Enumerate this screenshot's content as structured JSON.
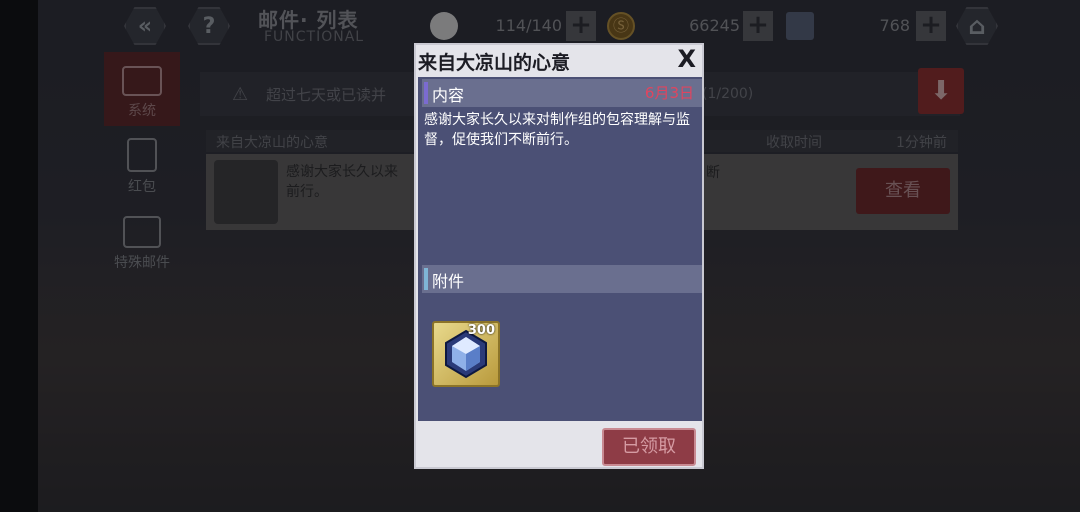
{
  "topbar": {
    "back_icon": "«",
    "help_icon": "?",
    "title": "邮件· 列表",
    "subtitle": "FUNCTIONAL",
    "stamina": "114/140",
    "coins": "66245",
    "gems": "768",
    "plus": "+",
    "home_icon": "⌂",
    "coin_glyph": "Ⓢ"
  },
  "sidebar": {
    "items": [
      {
        "label": "系统"
      },
      {
        "label": "红包"
      },
      {
        "label": "特殊邮件"
      }
    ]
  },
  "main": {
    "notice": "超过七天或已读并",
    "notice_icon": "⚠",
    "count": "(1/200)",
    "download_icon": "⬇",
    "list_header": {
      "title": "来自大凉山的心意",
      "received_label": "收取时间",
      "time": "1分钟前"
    },
    "mail": {
      "preview": "感谢大家长久以来",
      "preview_line2": "前行。",
      "tail": "断",
      "view_button": "查看"
    }
  },
  "modal": {
    "title": "来自大凉山的心意",
    "close": "X",
    "content_label": "内容",
    "date": "6月3日",
    "content": "感谢大家长久以来对制作组的包容理解与监督，促使我们不断前行。",
    "attachment_label": "附件",
    "attachment": {
      "icon": "gem-icon",
      "count": "300"
    },
    "claimed_button": "已领取"
  }
}
